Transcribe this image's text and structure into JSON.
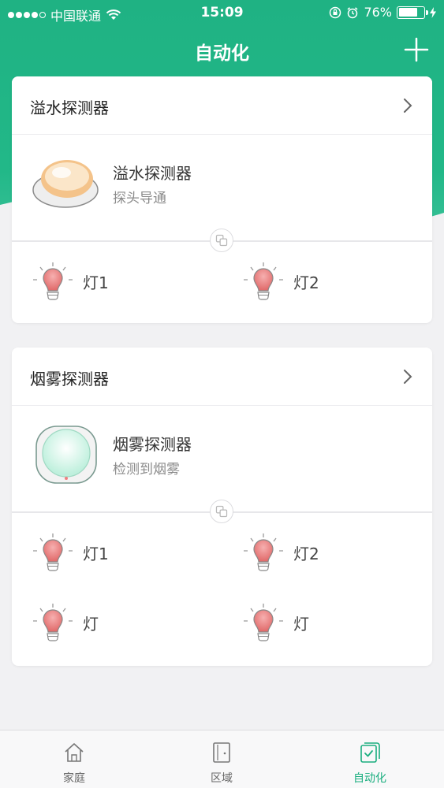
{
  "status_bar": {
    "carrier": "中国联通",
    "time": "15:09",
    "battery_percent": "76%",
    "battery_level": 0.76,
    "signal_dots_filled": 4
  },
  "nav": {
    "title": "自动化",
    "add_icon": "plus-icon"
  },
  "cards": [
    {
      "title": "溢水探测器",
      "trigger": {
        "name": "溢水探测器",
        "state": "探头导通",
        "icon": "water-leak-sensor-icon"
      },
      "actions": [
        {
          "label": "灯1",
          "icon": "bulb-icon"
        },
        {
          "label": "灯2",
          "icon": "bulb-icon"
        }
      ]
    },
    {
      "title": "烟雾探测器",
      "trigger": {
        "name": "烟雾探测器",
        "state": "检测到烟雾",
        "icon": "smoke-detector-icon"
      },
      "actions": [
        {
          "label": "灯1",
          "icon": "bulb-icon"
        },
        {
          "label": "灯2",
          "icon": "bulb-icon"
        },
        {
          "label": "灯",
          "icon": "bulb-icon"
        },
        {
          "label": "灯",
          "icon": "bulb-icon"
        }
      ]
    }
  ],
  "tabbar": {
    "tabs": [
      {
        "label": "家庭",
        "icon": "home-icon"
      },
      {
        "label": "区域",
        "icon": "door-icon"
      },
      {
        "label": "自动化",
        "icon": "automation-check-icon",
        "active": true
      }
    ],
    "accent_color": "#1aae7f"
  },
  "colors": {
    "brand": "#22b888",
    "background": "#f1f1f3"
  }
}
